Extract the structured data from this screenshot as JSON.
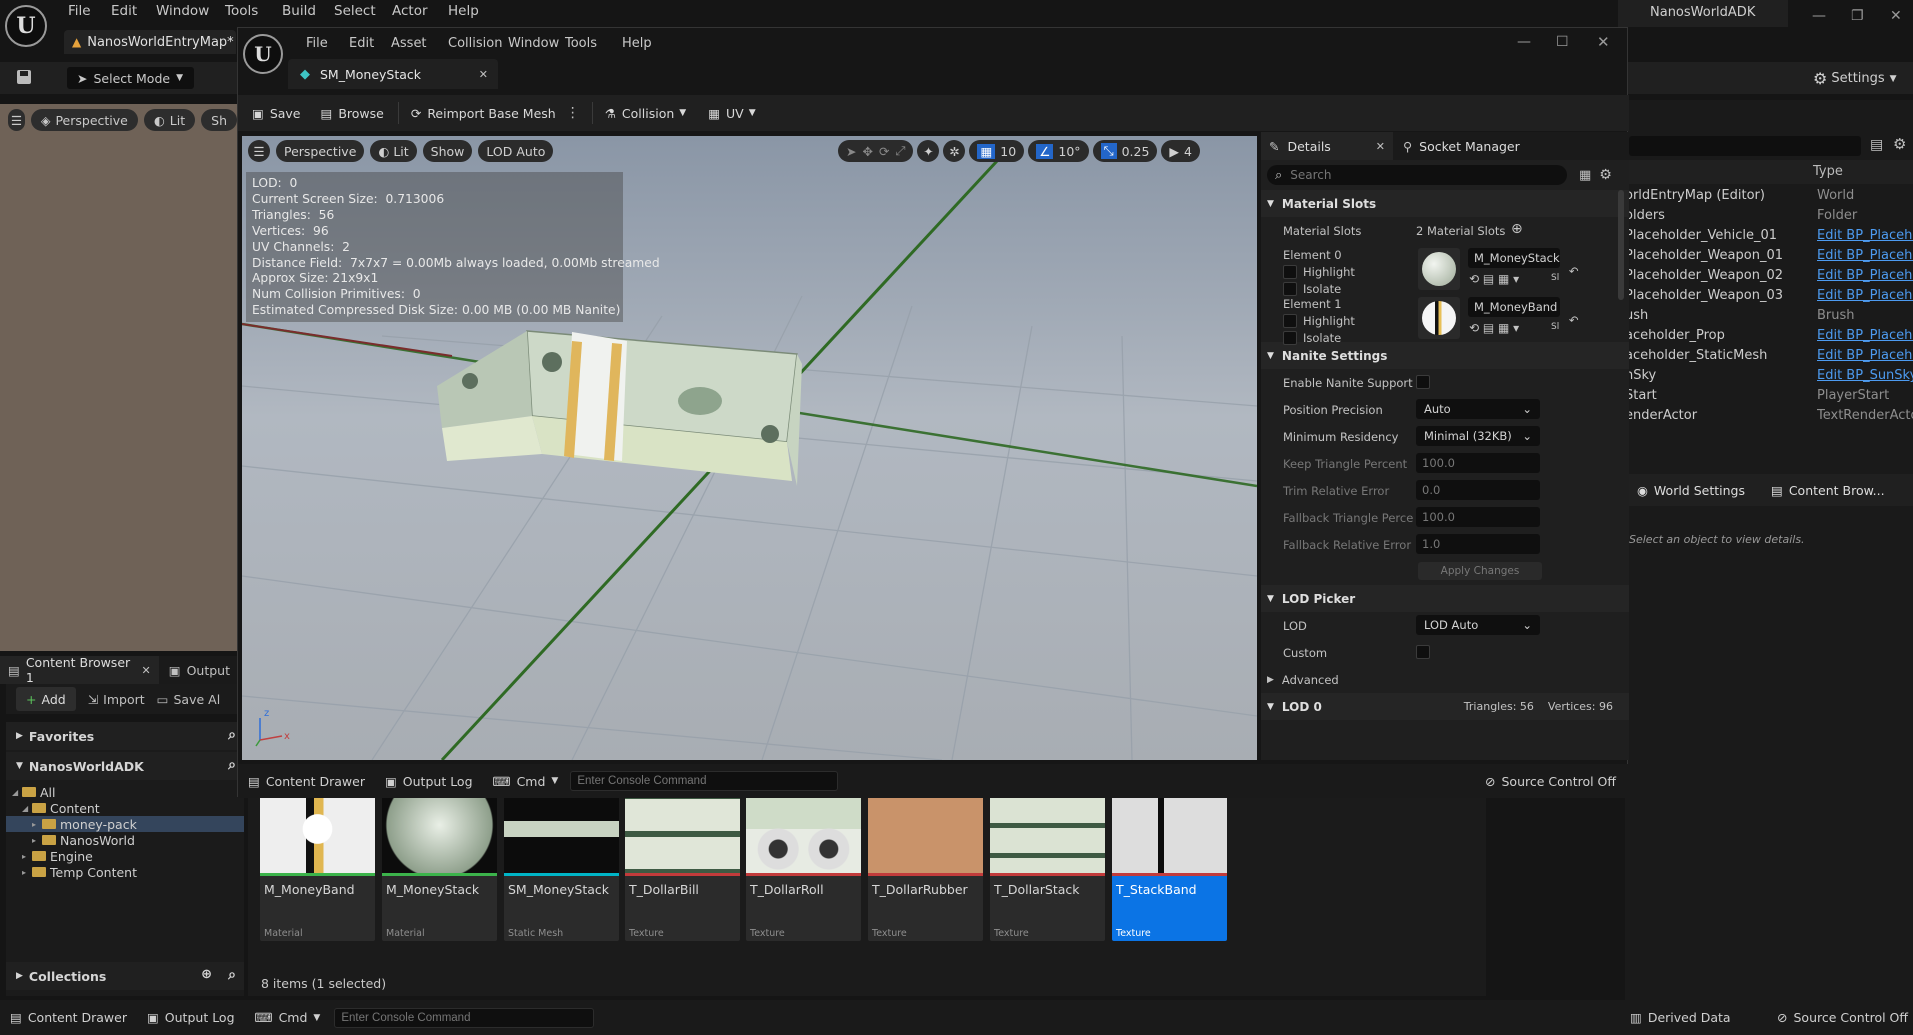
{
  "main": {
    "menu": [
      "File",
      "Edit",
      "Window",
      "Tools",
      "Build",
      "Select",
      "Actor",
      "Help"
    ],
    "project_name": "NanosWorldADK",
    "map_tab": "NanosWorldEntryMap*",
    "select_mode": "Select Mode",
    "settings": "Settings",
    "left_viewport": {
      "perspective": "Perspective",
      "lit": "Lit",
      "show": "Sh"
    }
  },
  "editor": {
    "menu": [
      "File",
      "Edit",
      "Asset",
      "Collision",
      "Window",
      "Tools",
      "Help"
    ],
    "tab_title": "SM_MoneyStack",
    "toolbar": {
      "save": "Save",
      "browse": "Browse",
      "reimport": "Reimport Base Mesh",
      "collision": "Collision",
      "uv": "UV"
    },
    "viewport": {
      "perspective": "Perspective",
      "lit": "Lit",
      "show": "Show",
      "lod": "LOD Auto",
      "grid": "10",
      "angle": "10°",
      "scale": "0.25",
      "camera": "4",
      "stats": [
        "LOD:  0",
        "Current Screen Size:  0.713006",
        "Triangles:  56",
        "Vertices:  96",
        "UV Channels:  2",
        "Distance Field:  7x7x7 = 0.00Mb always loaded, 0.00Mb streamed",
        "Approx Size: 21x9x1",
        "Num Collision Primitives:  0",
        "Estimated Compressed Disk Size: 0.00 MB (0.00 MB Nanite)"
      ]
    },
    "details": {
      "tab": "Details",
      "socket_tab": "Socket Manager",
      "search_placeholder": "Search",
      "material_slots_title": "Material Slots",
      "material_slots_label": "Material Slots",
      "material_slots_value": "2 Material Slots",
      "element0": "Element 0",
      "element1": "Element 1",
      "highlight": "Highlight",
      "isolate": "Isolate",
      "slot_trunc": "Sl",
      "mat0": "M_MoneyStack",
      "mat1": "M_MoneyBand",
      "nanite_title": "Nanite Settings",
      "nanite": [
        {
          "label": "Enable Nanite Support",
          "kind": "check"
        },
        {
          "label": "Position Precision",
          "kind": "select",
          "value": "Auto"
        },
        {
          "label": "Minimum Residency",
          "kind": "select",
          "value": "Minimal (32KB)"
        },
        {
          "label": "Keep Triangle Percent",
          "kind": "input",
          "value": "100.0"
        },
        {
          "label": "Trim Relative Error",
          "kind": "input",
          "value": "0.0"
        },
        {
          "label": "Fallback Triangle Perce",
          "kind": "input",
          "value": "100.0"
        },
        {
          "label": "Fallback Relative Error",
          "kind": "input",
          "value": "1.0"
        }
      ],
      "apply": "Apply Changes",
      "lod_picker_title": "LOD Picker",
      "lod_label": "LOD",
      "lod_value": "LOD Auto",
      "custom_label": "Custom",
      "advanced": "Advanced",
      "lod0": "LOD 0",
      "lod0_stats": "Triangles: 56    Vertices: 96"
    },
    "status": {
      "content_drawer": "Content Drawer",
      "output_log": "Output Log",
      "cmd": "Cmd",
      "console_placeholder": "Enter Console Command",
      "source_control": "Source Control Off"
    }
  },
  "content_browser": {
    "tab": "Content Browser 1",
    "output_tab": "Output",
    "add": "Add",
    "import": "Import",
    "save_all": "Save Al",
    "favorites": "Favorites",
    "root": "NanosWorldADK",
    "collections": "Collections",
    "tree": [
      {
        "label": "All",
        "depth": 0,
        "open": true
      },
      {
        "label": "Content",
        "depth": 1,
        "open": true
      },
      {
        "label": "money-pack",
        "depth": 2,
        "selected": true
      },
      {
        "label": "NanosWorld",
        "depth": 2
      },
      {
        "label": "Engine",
        "depth": 1
      },
      {
        "label": "Temp Content",
        "depth": 1
      }
    ],
    "assets": [
      {
        "name": "M_MoneyBand",
        "type": "Material",
        "color": "#3cb34b"
      },
      {
        "name": "M_MoneyStack",
        "type": "Material",
        "color": "#3cb34b"
      },
      {
        "name": "SM_MoneyStack",
        "type": "Static Mesh",
        "color": "#00b5c7"
      },
      {
        "name": "T_DollarBill",
        "type": "Texture",
        "color": "#c23b3b"
      },
      {
        "name": "T_DollarRoll",
        "type": "Texture",
        "color": "#c23b3b"
      },
      {
        "name": "T_DollarRubber",
        "type": "Texture",
        "color": "#c23b3b"
      },
      {
        "name": "T_DollarStack",
        "type": "Texture",
        "color": "#c23b3b"
      },
      {
        "name": "T_StackBand",
        "type": "Texture",
        "color": "#c23b3b",
        "selected": true
      }
    ],
    "count": "8 items (1 selected)"
  },
  "outliner": {
    "type_header": "Type",
    "rows": [
      {
        "name": "orldEntryMap (Editor)",
        "type": "World",
        "link": false
      },
      {
        "name": "olders",
        "type": "Folder",
        "link": false
      },
      {
        "name": "Placeholder_Vehicle_01",
        "type": "Edit BP_Placehol",
        "link": true
      },
      {
        "name": "Placeholder_Weapon_01",
        "type": "Edit BP_Placehol",
        "link": true
      },
      {
        "name": "Placeholder_Weapon_02",
        "type": "Edit BP_Placehol",
        "link": true
      },
      {
        "name": "Placeholder_Weapon_03",
        "type": "Edit BP_Placehol",
        "link": true
      },
      {
        "name": "ush",
        "type": "Brush",
        "link": false
      },
      {
        "name": "aceholder_Prop",
        "type": "Edit BP_Placehol",
        "link": true
      },
      {
        "name": "aceholder_StaticMesh",
        "type": "Edit BP_Placehol",
        "link": true
      },
      {
        "name": "nSky",
        "type": "Edit BP_SunSky",
        "link": true
      },
      {
        "name": "Start",
        "type": "PlayerStart",
        "link": false
      },
      {
        "name": "enderActor",
        "type": "TextRenderActor",
        "link": false
      }
    ],
    "world_settings": "World Settings",
    "content_browser": "Content Brow...",
    "empty_details": "Select an object to view details."
  },
  "status": {
    "content_drawer": "Content Drawer",
    "output_log": "Output Log",
    "cmd": "Cmd",
    "console_placeholder": "Enter Console Command",
    "derived_data": "Derived Data",
    "source_control": "Source Control Off"
  }
}
